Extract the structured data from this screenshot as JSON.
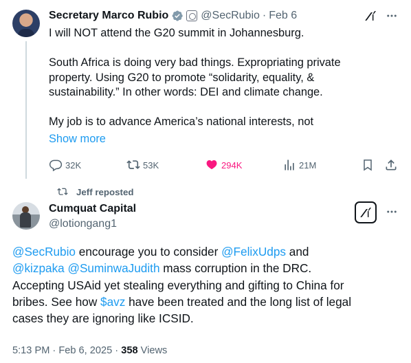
{
  "tweet": {
    "author_name": "Secretary Marco Rubio",
    "author_handle": "@SecRubio",
    "separator": "·",
    "timestamp": "Feb 6",
    "lines": [
      "I will NOT attend the G20 summit in Johannesburg.",
      "",
      "South Africa is doing very bad things. Expropriating private",
      "property. Using G20 to promote “solidarity, equality, &",
      "sustainability.” In other words: DEI and climate change.",
      "",
      "My job is to advance America’s national interests, not"
    ],
    "show_more": "Show more",
    "actions": {
      "replies": "32K",
      "reposts": "53K",
      "likes": "294K",
      "views": "21M"
    }
  },
  "repost_banner": {
    "text": "Jeff reposted"
  },
  "reply": {
    "author_name": "Cumquat Capital",
    "author_handle": "@lotiongang1",
    "line1": {
      "mention": "@SecRubio",
      "text_a": " encourage you to consider ",
      "mention2": "@FelixUdps",
      "text_b": " and"
    },
    "line2": {
      "mention": "@kizpaka",
      "sep": " ",
      "mention2": "@SuminwaJudith",
      "text": " mass corruption in the DRC."
    },
    "line3": "Accepting USAid yet stealing everything and gifting to China for",
    "line4": {
      "text_a": "bribes. See how ",
      "cashtag": "$avz",
      "text_b": " have been treated and the long list of legal"
    },
    "line5": "cases they are ignoring like ICSID.",
    "meta": {
      "time": "5:13 PM",
      "separator": " · ",
      "date": "Feb 6, 2025",
      "separator2": " · ",
      "views_count": "358",
      "views_label": " Views"
    }
  },
  "colors": {
    "accent": "#1d9bf0",
    "like": "#f91880",
    "muted": "#536471",
    "text": "#0f1419"
  },
  "icons": [
    "verified-badge-icon",
    "government-seal-icon",
    "grok-icon",
    "more-icon",
    "reply-icon",
    "repost-icon",
    "like-icon",
    "views-icon",
    "bookmark-icon",
    "share-icon"
  ]
}
